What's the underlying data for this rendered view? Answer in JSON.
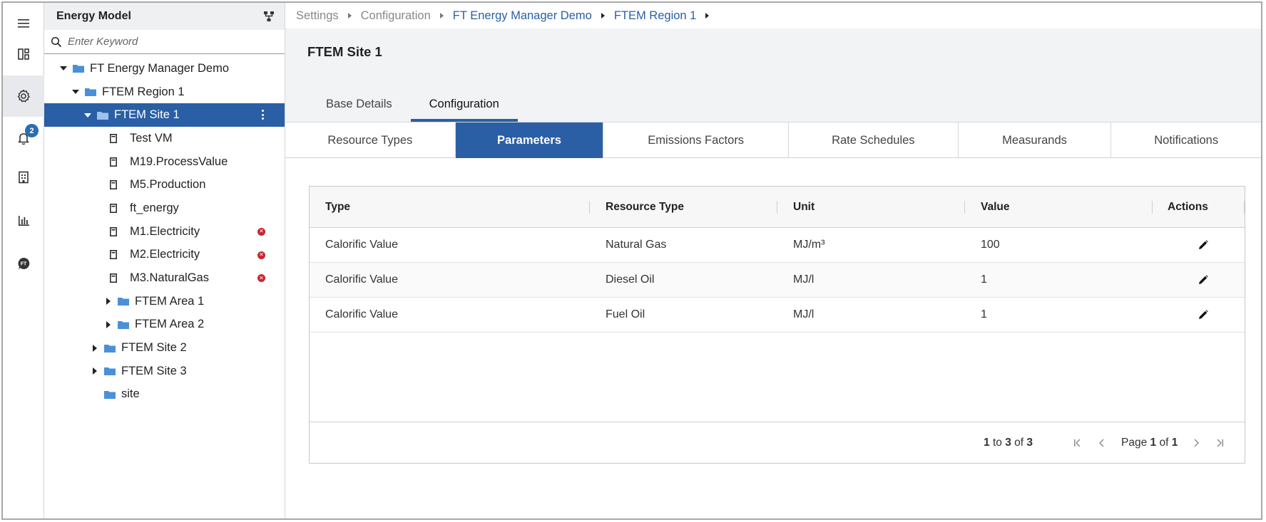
{
  "rail": {
    "notifications_badge": "2",
    "items": [
      {
        "icon": "menu-icon"
      },
      {
        "icon": "dashboard-icon"
      },
      {
        "icon": "gear-icon"
      },
      {
        "icon": "bell-icon"
      },
      {
        "icon": "report-icon"
      },
      {
        "icon": "bar-chart-icon"
      },
      {
        "icon": "ft-logo-icon"
      }
    ]
  },
  "tree": {
    "title": "Energy Model",
    "search_placeholder": "Enter Keyword",
    "nodes": [
      {
        "label": "FT Energy Manager Demo"
      },
      {
        "label": "FTEM Region 1"
      },
      {
        "label": "FTEM Site 1"
      },
      {
        "label": "Test VM"
      },
      {
        "label": "M19.ProcessValue"
      },
      {
        "label": "M5.Production"
      },
      {
        "label": "ft_energy"
      },
      {
        "label": "M1.Electricity"
      },
      {
        "label": "M2.Electricity"
      },
      {
        "label": "M3.NaturalGas"
      },
      {
        "label": "FTEM Area 1"
      },
      {
        "label": "FTEM Area 2"
      },
      {
        "label": "FTEM Site 2"
      },
      {
        "label": "FTEM Site 3"
      },
      {
        "label": "site"
      }
    ]
  },
  "breadcrumb": [
    "Settings",
    "Configuration",
    "FT Energy Manager Demo",
    "FTEM Region 1"
  ],
  "page": {
    "title": "FTEM Site 1",
    "tabs": [
      "Base Details",
      "Configuration"
    ]
  },
  "subtabs": [
    "Resource Types",
    "Parameters",
    "Emissions Factors",
    "Rate Schedules",
    "Measurands",
    "Notifications"
  ],
  "grid": {
    "columns": [
      "Type",
      "Resource Type",
      "Unit",
      "Value",
      "Actions"
    ],
    "rows": [
      {
        "type": "Calorific Value",
        "resource_type": "Natural Gas",
        "unit": "MJ/m³",
        "value": "100"
      },
      {
        "type": "Calorific Value",
        "resource_type": "Diesel Oil",
        "unit": "MJ/l",
        "value": "1"
      },
      {
        "type": "Calorific Value",
        "resource_type": "Fuel Oil",
        "unit": "MJ/l",
        "value": "1"
      }
    ],
    "pagination": {
      "from": "1",
      "to_word": "to",
      "to": "3",
      "of_word": "of",
      "total": "3",
      "page_word": "Page",
      "page": "1",
      "page_of_word": "of",
      "pages": "1"
    }
  },
  "colors": {
    "accent": "#2a5fa5",
    "error": "#c8262d",
    "folder": "#4a90d9"
  }
}
